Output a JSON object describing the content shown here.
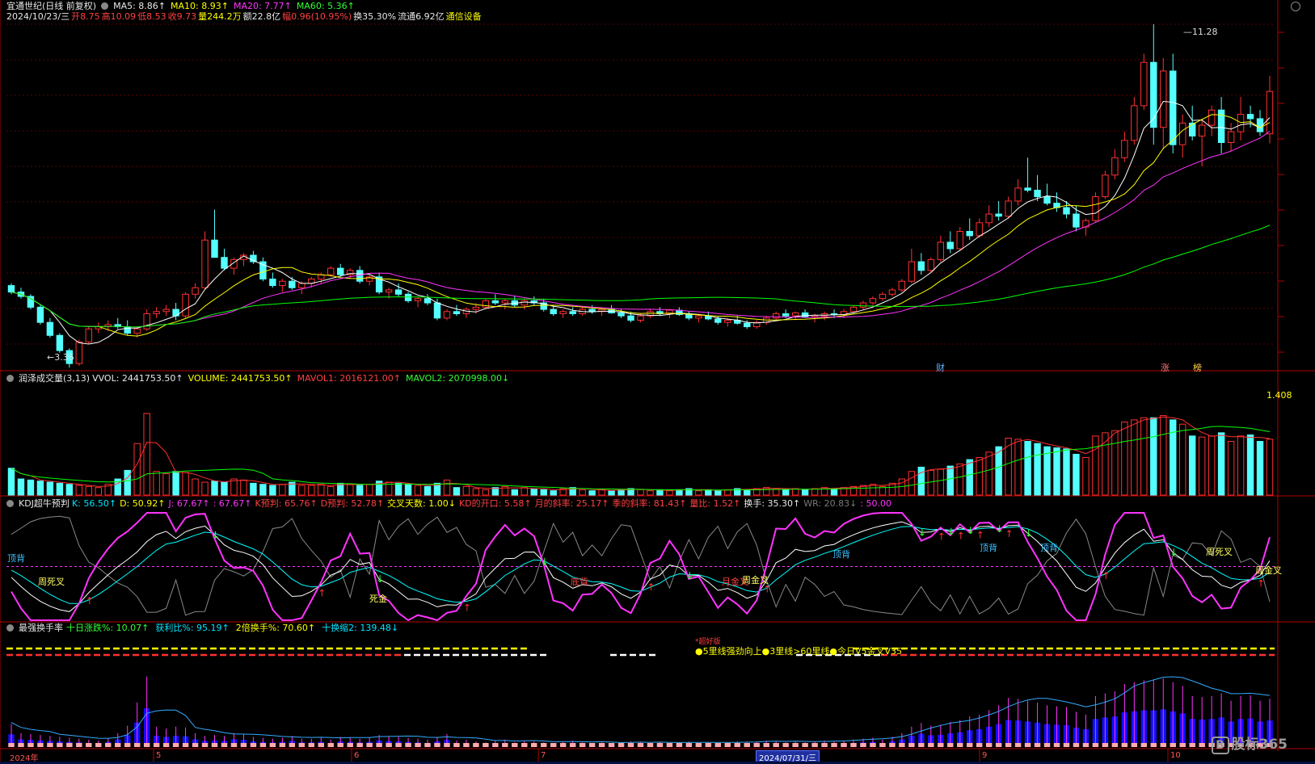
{
  "app": {
    "stock_title": "宜通世纪(日线 前复权)",
    "ma5": "MA5: 8.86↑",
    "ma10": "MA10: 8.93↑",
    "ma20": "MA20: 7.77↑",
    "ma60": "MA60: 5.36↑",
    "quote": {
      "date": "2024/10/23/三",
      "open": "开8.75",
      "high": "高10.09",
      "low": "低8.53",
      "close": "收9.73",
      "vol": "量244.2万",
      "amount": "额22.8亿",
      "change": "幅0.96(10.95%)",
      "turnover": "换35.30%",
      "float": "流通6.92亿",
      "sector": "通信设备"
    },
    "price_high_label": "11.28",
    "price_low_label": "3.36",
    "marks": {
      "cai": "财",
      "zhang": "涨",
      "bang": "榜"
    },
    "vol_panel": {
      "name": "润泽成交量(3,13)",
      "vvol": "VVOL: 2441753.50↑",
      "volume": "VOLUME: 2441753.50↑",
      "mavol1": "MAVOL1: 2016121.00↑",
      "mavol2": "MAVOL2: 2070998.00↓",
      "right_label": "1.408"
    },
    "kdj_panel": {
      "name": "KDJ超牛预判",
      "k": "K: 56.50↑",
      "d": "D: 50.92↑",
      "j": "J: 67.67↑",
      "jj": ": 67.67↑",
      "kpred": "K预判: 65.76↑",
      "dpred": "D预判: 52.78↑",
      "cross_days": "交叉天数: 1.00↓",
      "kd_open": "KD的开口: 5.58↑",
      "month_rate": "月的斜率: 25.17↑",
      "season_rate": "季的斜率: 81.43↑",
      "vol_ratio": "量比: 1.52↑",
      "turnover": "换手: 35.30↑",
      "wr": "WR: 20.83↓",
      "fifty": ": 50.00",
      "labels": {
        "dingbei": "顶背",
        "zhousicha": "周死叉",
        "zhoujincha": "周金叉",
        "yuejincha": "月金叉",
        "sijin": "死金",
        "dibei": "底背"
      }
    },
    "turn_panel": {
      "name": "最强换手率",
      "ten_day": "十日涨跌%: 10.07↑",
      "profit": "获利比%: 95.19↑",
      "double": "2倍换手%: 70.60↑",
      "shrink": "十换缩2: 139.48↓",
      "signal": "●5里线强劲向上●3里线>60里线●今日V5金叉V35",
      "top_small": "*超好版"
    },
    "x_axis": {
      "year": "2024年",
      "m5": "5",
      "m6": "6",
      "m7": "7",
      "m9": "9",
      "m10": "10",
      "cursor_date": "2024/07/31/三"
    },
    "logo": "股标365",
    "logo_mark": "B"
  },
  "chart_data": {
    "type": "candlestick",
    "price_range": [
      3.36,
      11.28
    ],
    "colors": {
      "up": "#ff3030",
      "down": "#54ffff",
      "ma5": "#ffffff",
      "ma10": "#ffff00",
      "ma20": "#ff33ff",
      "ma60": "#00ff00",
      "vol_ma1": "#ff3030",
      "vol_ma2": "#00ff00",
      "kdj_k": "#ffffff",
      "kdj_d": "#00ffff",
      "kdj_j": "#ff33ff",
      "wr": "#888888"
    },
    "ohlc": [
      [
        5.25,
        5.3,
        5.05,
        5.1
      ],
      [
        5.1,
        5.2,
        4.95,
        5.0
      ],
      [
        5.0,
        5.05,
        4.7,
        4.75
      ],
      [
        4.75,
        4.8,
        4.35,
        4.4
      ],
      [
        4.4,
        4.5,
        4.05,
        4.1
      ],
      [
        4.1,
        4.15,
        3.7,
        3.75
      ],
      [
        3.75,
        3.8,
        3.36,
        3.45
      ],
      [
        3.45,
        4.0,
        3.4,
        3.95
      ],
      [
        3.95,
        4.3,
        3.9,
        4.25
      ],
      [
        4.25,
        4.4,
        4.15,
        4.3
      ],
      [
        4.3,
        4.45,
        4.2,
        4.35
      ],
      [
        4.35,
        4.5,
        4.25,
        4.3
      ],
      [
        4.3,
        4.45,
        4.1,
        4.15
      ],
      [
        4.15,
        4.3,
        4.05,
        4.25
      ],
      [
        4.25,
        4.7,
        4.2,
        4.6
      ],
      [
        4.6,
        4.75,
        4.5,
        4.65
      ],
      [
        4.65,
        4.8,
        4.55,
        4.7
      ],
      [
        4.7,
        4.85,
        4.45,
        4.55
      ],
      [
        4.55,
        5.1,
        4.5,
        5.05
      ],
      [
        5.05,
        5.3,
        4.95,
        5.2
      ],
      [
        5.2,
        6.5,
        5.15,
        6.3
      ],
      [
        6.3,
        7.0,
        6.2,
        5.9
      ],
      [
        5.9,
        6.1,
        5.6,
        5.65
      ],
      [
        5.65,
        5.9,
        5.5,
        5.85
      ],
      [
        5.85,
        6.0,
        5.7,
        5.95
      ],
      [
        5.95,
        6.05,
        5.75,
        5.8
      ],
      [
        5.8,
        5.9,
        5.35,
        5.4
      ],
      [
        5.4,
        5.55,
        5.2,
        5.25
      ],
      [
        5.25,
        5.4,
        5.1,
        5.35
      ],
      [
        5.35,
        5.45,
        5.15,
        5.2
      ],
      [
        5.2,
        5.35,
        5.05,
        5.3
      ],
      [
        5.3,
        5.45,
        5.2,
        5.4
      ],
      [
        5.4,
        5.55,
        5.3,
        5.5
      ],
      [
        5.5,
        5.7,
        5.45,
        5.65
      ],
      [
        5.65,
        5.75,
        5.45,
        5.5
      ],
      [
        5.5,
        5.65,
        5.4,
        5.6
      ],
      [
        5.6,
        5.7,
        5.3,
        5.35
      ],
      [
        5.35,
        5.5,
        5.25,
        5.45
      ],
      [
        5.45,
        5.55,
        5.05,
        5.1
      ],
      [
        5.1,
        5.2,
        4.95,
        5.15
      ],
      [
        5.15,
        5.3,
        5.0,
        5.05
      ],
      [
        5.05,
        5.1,
        4.85,
        4.9
      ],
      [
        4.9,
        5.0,
        4.75,
        4.95
      ],
      [
        4.95,
        5.05,
        4.8,
        4.85
      ],
      [
        4.85,
        4.95,
        4.45,
        4.5
      ],
      [
        4.5,
        4.7,
        4.45,
        4.65
      ],
      [
        4.65,
        4.8,
        4.55,
        4.6
      ],
      [
        4.6,
        4.75,
        4.5,
        4.7
      ],
      [
        4.7,
        4.85,
        4.6,
        4.75
      ],
      [
        4.75,
        4.95,
        4.7,
        4.9
      ],
      [
        4.9,
        5.05,
        4.8,
        4.85
      ],
      [
        4.85,
        4.95,
        4.7,
        4.9
      ],
      [
        4.9,
        5.0,
        4.75,
        4.8
      ],
      [
        4.8,
        4.95,
        4.7,
        4.9
      ],
      [
        4.9,
        5.0,
        4.8,
        4.85
      ],
      [
        4.85,
        4.95,
        4.65,
        4.7
      ],
      [
        4.7,
        4.8,
        4.55,
        4.6
      ],
      [
        4.6,
        4.7,
        4.5,
        4.65
      ],
      [
        4.65,
        4.75,
        4.55,
        4.6
      ],
      [
        4.6,
        4.75,
        4.55,
        4.7
      ],
      [
        4.7,
        4.8,
        4.6,
        4.65
      ],
      [
        4.65,
        4.75,
        4.55,
        4.7
      ],
      [
        4.7,
        4.8,
        4.6,
        4.62
      ],
      [
        4.62,
        4.7,
        4.5,
        4.55
      ],
      [
        4.55,
        4.65,
        4.4,
        4.45
      ],
      [
        4.45,
        4.6,
        4.4,
        4.55
      ],
      [
        4.55,
        4.7,
        4.5,
        4.65
      ],
      [
        4.65,
        4.75,
        4.55,
        4.6
      ],
      [
        4.6,
        4.7,
        4.5,
        4.68
      ],
      [
        4.68,
        4.75,
        4.55,
        4.58
      ],
      [
        4.58,
        4.65,
        4.45,
        4.5
      ],
      [
        4.5,
        4.6,
        4.4,
        4.55
      ],
      [
        4.55,
        4.65,
        4.45,
        4.48
      ],
      [
        4.48,
        4.55,
        4.35,
        4.4
      ],
      [
        4.4,
        4.5,
        4.3,
        4.45
      ],
      [
        4.45,
        4.55,
        4.35,
        4.38
      ],
      [
        4.38,
        4.45,
        4.25,
        4.3
      ],
      [
        4.3,
        4.45,
        4.25,
        4.4
      ],
      [
        4.4,
        4.55,
        4.35,
        4.5
      ],
      [
        4.5,
        4.65,
        4.45,
        4.6
      ],
      [
        4.6,
        4.7,
        4.5,
        4.55
      ],
      [
        4.55,
        4.65,
        4.45,
        4.62
      ],
      [
        4.62,
        4.7,
        4.5,
        4.52
      ],
      [
        4.52,
        4.6,
        4.4,
        4.55
      ],
      [
        4.55,
        4.65,
        4.45,
        4.6
      ],
      [
        4.6,
        4.7,
        4.5,
        4.58
      ],
      [
        4.58,
        4.7,
        4.5,
        4.65
      ],
      [
        4.65,
        4.8,
        4.6,
        4.75
      ],
      [
        4.75,
        4.9,
        4.7,
        4.85
      ],
      [
        4.85,
        5.0,
        4.8,
        4.95
      ],
      [
        4.95,
        5.1,
        4.9,
        5.05
      ],
      [
        5.05,
        5.2,
        5.0,
        5.15
      ],
      [
        5.15,
        5.4,
        5.1,
        5.35
      ],
      [
        5.35,
        6.1,
        5.3,
        5.8
      ],
      [
        5.8,
        6.0,
        5.5,
        5.6
      ],
      [
        5.6,
        5.9,
        5.55,
        5.85
      ],
      [
        5.85,
        6.4,
        5.8,
        6.25
      ],
      [
        6.25,
        6.5,
        6.0,
        6.1
      ],
      [
        6.1,
        6.6,
        6.05,
        6.5
      ],
      [
        6.5,
        6.8,
        6.3,
        6.4
      ],
      [
        6.4,
        6.8,
        6.35,
        6.7
      ],
      [
        6.7,
        7.1,
        6.6,
        6.9
      ],
      [
        6.9,
        7.2,
        6.75,
        6.85
      ],
      [
        6.85,
        7.3,
        6.8,
        7.2
      ],
      [
        7.2,
        7.7,
        7.1,
        7.5
      ],
      [
        7.5,
        8.2,
        7.4,
        7.45
      ],
      [
        7.45,
        7.8,
        7.2,
        7.3
      ],
      [
        7.3,
        7.6,
        7.1,
        7.15
      ],
      [
        7.15,
        7.4,
        6.95,
        7.05
      ],
      [
        7.05,
        7.2,
        6.8,
        6.9
      ],
      [
        6.9,
        7.1,
        6.5,
        6.6
      ],
      [
        6.6,
        6.8,
        6.4,
        6.75
      ],
      [
        6.75,
        7.4,
        6.7,
        7.3
      ],
      [
        7.3,
        7.9,
        7.25,
        7.8
      ],
      [
        7.8,
        8.4,
        7.7,
        8.2
      ],
      [
        8.2,
        8.8,
        8.1,
        8.6
      ],
      [
        8.6,
        9.6,
        8.5,
        9.4
      ],
      [
        9.4,
        10.6,
        9.3,
        10.4
      ],
      [
        10.4,
        11.28,
        8.5,
        8.9
      ],
      [
        8.9,
        10.5,
        8.4,
        10.2
      ],
      [
        10.2,
        10.6,
        8.3,
        8.5
      ],
      [
        8.5,
        9.2,
        8.2,
        9.0
      ],
      [
        9.0,
        9.4,
        8.6,
        8.7
      ],
      [
        8.7,
        9.1,
        8.0,
        8.95
      ],
      [
        8.95,
        9.4,
        8.7,
        9.3
      ],
      [
        9.3,
        9.6,
        8.3,
        8.55
      ],
      [
        8.55,
        9.0,
        8.35,
        8.8
      ],
      [
        8.8,
        9.6,
        8.6,
        9.2
      ],
      [
        9.2,
        9.4,
        8.9,
        9.1
      ],
      [
        9.1,
        9.3,
        8.7,
        8.8
      ],
      [
        8.75,
        10.09,
        8.53,
        9.73
      ]
    ],
    "volume_ratio": [
      0.25,
      0.15,
      0.14,
      0.13,
      0.12,
      0.11,
      0.1,
      0.09,
      0.08,
      0.07,
      0.1,
      0.15,
      0.23,
      0.48,
      0.76,
      0.22,
      0.2,
      0.22,
      0.21,
      0.15,
      0.12,
      0.13,
      0.12,
      0.15,
      0.14,
      0.11,
      0.1,
      0.09,
      0.1,
      0.12,
      0.09,
      0.09,
      0.1,
      0.08,
      0.11,
      0.1,
      0.09,
      0.1,
      0.13,
      0.12,
      0.11,
      0.1,
      0.09,
      0.08,
      0.11,
      0.14,
      0.07,
      0.08,
      0.06,
      0.05,
      0.07,
      0.08,
      0.05,
      0.07,
      0.06,
      0.05,
      0.04,
      0.06,
      0.07,
      0.05,
      0.04,
      0.05,
      0.04,
      0.05,
      0.06,
      0.05,
      0.04,
      0.05,
      0.04,
      0.05,
      0.06,
      0.04,
      0.05,
      0.04,
      0.05,
      0.06,
      0.05,
      0.06,
      0.07,
      0.06,
      0.05,
      0.06,
      0.05,
      0.06,
      0.07,
      0.06,
      0.07,
      0.08,
      0.09,
      0.1,
      0.08,
      0.11,
      0.15,
      0.22,
      0.26,
      0.23,
      0.24,
      0.27,
      0.29,
      0.33,
      0.35,
      0.4,
      0.45,
      0.53,
      0.52,
      0.5,
      0.48,
      0.45,
      0.44,
      0.43,
      0.38,
      0.35,
      0.55,
      0.58,
      0.6,
      0.68,
      0.7,
      0.72,
      0.72,
      0.74,
      0.7,
      0.66,
      0.55,
      0.54,
      0.55,
      0.58,
      0.5,
      0.55,
      0.56,
      0.5,
      0.52,
      0.53,
      0.61
    ]
  }
}
